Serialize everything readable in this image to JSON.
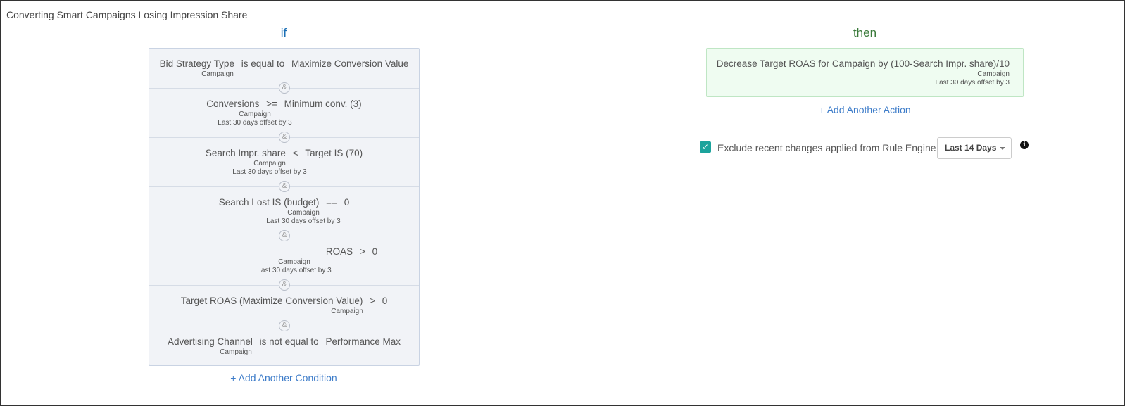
{
  "rule": {
    "title": "Converting Smart Campaigns Losing Impression Share"
  },
  "if_section": {
    "heading": "if",
    "conditions": [
      {
        "metric": "Bid Strategy Type",
        "operator": "is equal to",
        "value": "Maximize Conversion Value",
        "scope": "Campaign",
        "period": ""
      },
      {
        "metric": "Conversions",
        "operator": ">=",
        "value": "Minimum conv. (3)",
        "scope": "Campaign",
        "period": "Last 30 days offset by 3"
      },
      {
        "metric": "Search Impr. share",
        "operator": "<",
        "value": "Target IS (70)",
        "scope": "Campaign",
        "period": "Last 30 days offset by 3"
      },
      {
        "metric": "Search Lost IS (budget)",
        "operator": "==",
        "value": "0",
        "scope": "Campaign",
        "period": "Last 30 days offset by 3"
      },
      {
        "metric": "ROAS",
        "operator": ">",
        "value": "0",
        "scope": "Campaign",
        "period": "Last 30 days offset by 3"
      },
      {
        "metric": "Target ROAS (Maximize Conversion Value)",
        "operator": ">",
        "value": "0",
        "scope": "Campaign",
        "period": ""
      },
      {
        "metric": "Advertising Channel",
        "operator": "is not equal to",
        "value": "Performance Max",
        "scope": "Campaign",
        "period": ""
      }
    ],
    "connector": "&",
    "add_label": "+ Add Another Condition"
  },
  "then_section": {
    "heading": "then",
    "action": {
      "text": "Decrease Target ROAS for Campaign by (100-Search Impr. share)/10",
      "scope": "Campaign",
      "period": "Last 30 days offset by 3"
    },
    "add_label": "+ Add Another Action",
    "exclude_label": "Exclude recent changes applied from Rule Engine",
    "exclude_checked": true,
    "period_dropdown": "Last 14 Days",
    "check_glyph": "✓",
    "info_glyph": "i"
  },
  "colors": {
    "if_heading": "#1a6fb5",
    "then_heading": "#3a7a3a",
    "link": "#3d7cc9",
    "checkbox": "#1ba39c",
    "condition_bg": "#f1f3f7",
    "action_bg": "#effcf1"
  },
  "icons": {
    "check": "check-icon",
    "info": "info-icon",
    "dropdown": "chevron-down-icon",
    "connector": "ampersand-connector-icon"
  }
}
